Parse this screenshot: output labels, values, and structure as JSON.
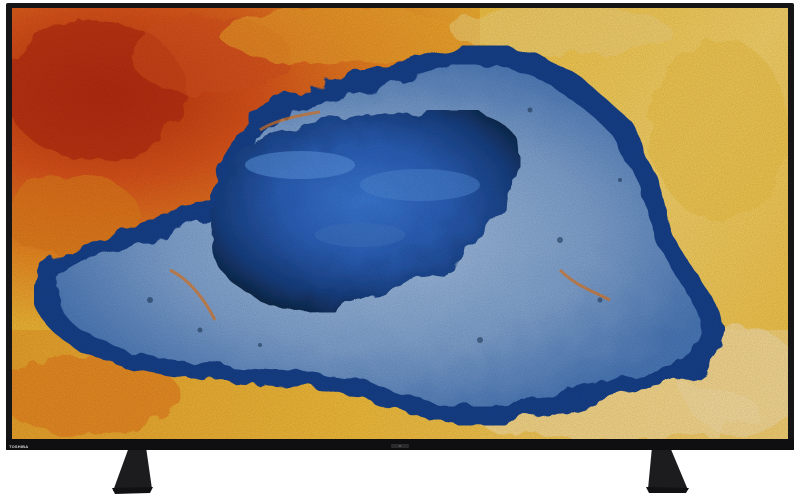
{
  "product": {
    "brand_logo": "TOSHIBA"
  },
  "colors": {
    "bezel": "#151517",
    "stand": "#1c1c1e",
    "orange": "#e6711c",
    "deep_orange": "#c2370d",
    "yellow": "#f1c034",
    "cream": "#f5dfa3",
    "blue": "#2d66c9",
    "light_blue": "#8fb0d6",
    "dark_blue": "#0d2748"
  },
  "icons": {
    "tv": "television-icon",
    "led": "status-led-icon"
  }
}
